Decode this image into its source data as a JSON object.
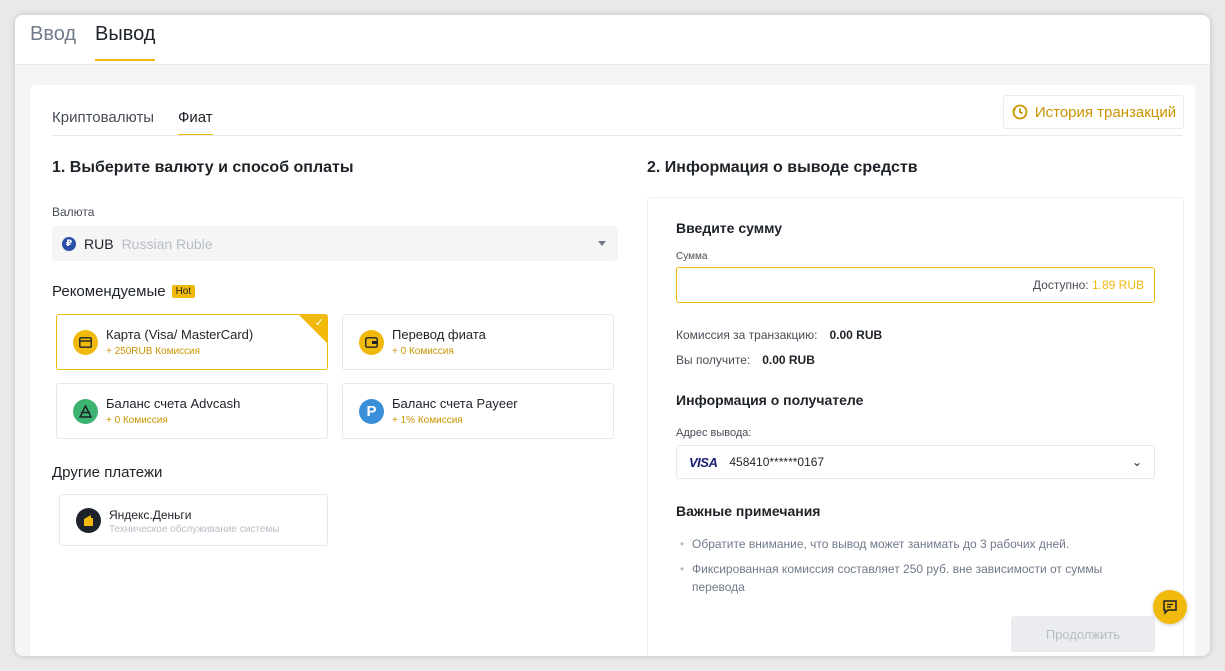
{
  "top_tabs": {
    "deposit": "Ввод",
    "withdraw": "Вывод"
  },
  "sub_tabs": {
    "crypto": "Криптовалюты",
    "fiat": "Фиат"
  },
  "history_button": "История транзакций",
  "left": {
    "step_title": "1. Выберите валюту и способ оплаты",
    "currency_label": "Валюта",
    "currency": {
      "code": "RUB",
      "name": "Russian Ruble",
      "icon_glyph": "₽"
    },
    "recommended_title": "Рекомендуемые",
    "hot_badge": "Hot",
    "methods": [
      {
        "name": "Карта (Visa/ MasterCard)",
        "fee": "+ 250RUB Комиссия",
        "icon": "card-icon",
        "color": "#f0b90b",
        "selected": true
      },
      {
        "name": "Перевод фиата",
        "fee": "+ 0 Комиссия",
        "icon": "wallet-icon",
        "color": "#f0b90b",
        "selected": false
      },
      {
        "name": "Баланс счета Advcash",
        "fee": "+ 0 Комиссия",
        "icon": "advcash-icon",
        "color": "#3cb371",
        "selected": false
      },
      {
        "name": "Баланс счета Payeer",
        "fee": "+ 1% Комиссия",
        "icon": "payeer-icon",
        "color": "#3b8fd9",
        "selected": false
      }
    ],
    "other_title": "Другие платежи",
    "other_method": {
      "name": "Яндекс.Деньги",
      "sub": "Техническое обслуживание системы",
      "icon": "yandex-money-icon"
    }
  },
  "right": {
    "step_title": "2. Информация о выводе средств",
    "amount_title": "Введите сумму",
    "amount_label": "Сумма",
    "available_label": "Доступно:",
    "available_value": "1.89 RUB",
    "fee_label": "Комиссия за транзакцию:",
    "fee_value": "0.00 RUB",
    "receive_label": "Вы получите:",
    "receive_value": "0.00 RUB",
    "recipient_title": "Информация о получателе",
    "address_label": "Адрес вывода:",
    "card_brand": "VISA",
    "card_number": "458410******0167",
    "notes_title": "Важные примечания",
    "notes": [
      "Обратите внимание, что вывод может занимать до 3 рабочих дней.",
      "Фиксированная комиссия составляет 250 руб. вне зависимости от суммы перевода"
    ],
    "continue_button": "Продолжить"
  },
  "colors": {
    "accent": "#f0b90b",
    "accent_text": "#c99400"
  }
}
